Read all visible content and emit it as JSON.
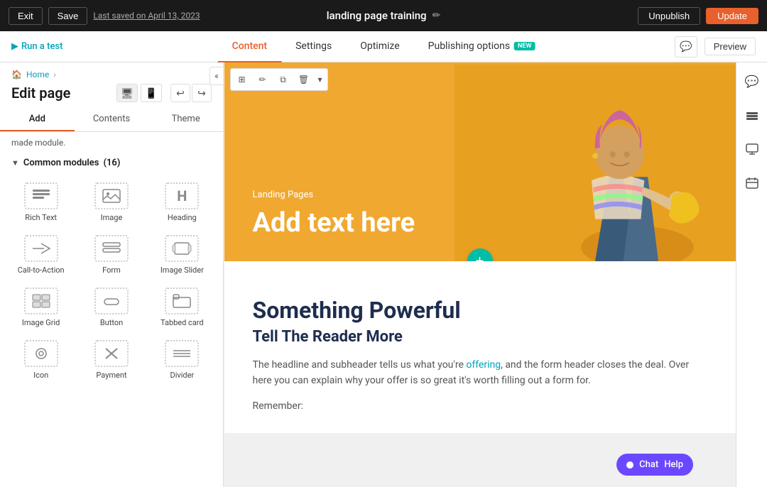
{
  "topbar": {
    "exit_label": "Exit",
    "save_label": "Save",
    "last_saved": "Last saved on April 13, 2023",
    "page_title": "landing page training",
    "unpublish_label": "Unpublish",
    "update_label": "Update"
  },
  "secondbar": {
    "run_test_label": "Run a test",
    "tabs": [
      {
        "label": "Content",
        "active": true
      },
      {
        "label": "Settings",
        "active": false
      },
      {
        "label": "Optimize",
        "active": false
      },
      {
        "label": "Publishing options",
        "active": false,
        "badge": "NEW"
      }
    ],
    "preview_label": "Preview"
  },
  "left_panel": {
    "breadcrumb_home": "Home",
    "edit_title": "Edit page",
    "tabs": [
      {
        "label": "Add",
        "active": true
      },
      {
        "label": "Contents",
        "active": false
      },
      {
        "label": "Theme",
        "active": false
      }
    ],
    "helper_text": "made module.",
    "section_title": "Common modules",
    "section_count": "(16)",
    "modules": [
      {
        "label": "Rich Text",
        "icon": "≡"
      },
      {
        "label": "Image",
        "icon": "🖼"
      },
      {
        "label": "Heading",
        "icon": "H"
      },
      {
        "label": "Call-to-Action",
        "icon": "↗"
      },
      {
        "label": "Form",
        "icon": "▤"
      },
      {
        "label": "Image Slider",
        "icon": "⊡"
      },
      {
        "label": "Image Grid",
        "icon": "⊞"
      },
      {
        "label": "Button",
        "icon": "▬"
      },
      {
        "label": "Tabbed card",
        "icon": "⊟"
      },
      {
        "label": "Icon",
        "icon": "◎"
      },
      {
        "label": "Payment",
        "icon": "✂"
      },
      {
        "label": "Divider",
        "icon": "—"
      }
    ]
  },
  "canvas": {
    "hero": {
      "tag": "Landing Pages",
      "title": "Add text here"
    },
    "content": {
      "title": "Something Powerful",
      "subtitle": "Tell The Reader More",
      "body1": "The headline and subheader tells us what you're ",
      "link_text": "offering",
      "body2": ", and the form header closes the deal. Over here you can explain why your offer is so great it's worth filling out a form for.",
      "remember": "Remember:"
    }
  },
  "chat": {
    "label": "Chat",
    "help_label": "Help"
  }
}
